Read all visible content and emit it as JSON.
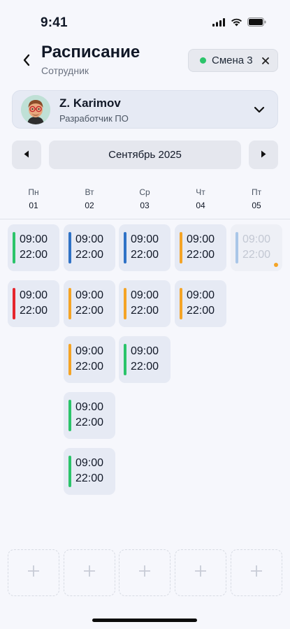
{
  "status_bar": {
    "time": "9:41"
  },
  "header": {
    "title": "Расписание",
    "subtitle": "Сотрудник",
    "shift_chip": {
      "label": "Смена 3",
      "dot_color": "#2bc46a"
    }
  },
  "employee": {
    "name": "Z. Karimov",
    "role": "Разработчик ПО"
  },
  "month": {
    "label": "Сентябрь 2025"
  },
  "days": [
    {
      "name": "Пн",
      "num": "01"
    },
    {
      "name": "Вт",
      "num": "02"
    },
    {
      "name": "Ср",
      "num": "03"
    },
    {
      "name": "Чт",
      "num": "04"
    },
    {
      "name": "Пт",
      "num": "05"
    }
  ],
  "colors": {
    "green": "#2bc46a",
    "blue": "#2f72c6",
    "orange": "#f4a426",
    "red": "#e5252d",
    "faded_blue": "#a9c6e8"
  },
  "shifts": [
    {
      "day": 0,
      "row": 0,
      "start": "09:00",
      "end": "22:00",
      "color": "green"
    },
    {
      "day": 0,
      "row": 1,
      "start": "09:00",
      "end": "22:00",
      "color": "red"
    },
    {
      "day": 1,
      "row": 0,
      "start": "09:00",
      "end": "22:00",
      "color": "blue"
    },
    {
      "day": 1,
      "row": 1,
      "start": "09:00",
      "end": "22:00",
      "color": "orange"
    },
    {
      "day": 1,
      "row": 2,
      "start": "09:00",
      "end": "22:00",
      "color": "orange"
    },
    {
      "day": 1,
      "row": 3,
      "start": "09:00",
      "end": "22:00",
      "color": "green"
    },
    {
      "day": 1,
      "row": 4,
      "start": "09:00",
      "end": "22:00",
      "color": "green"
    },
    {
      "day": 2,
      "row": 0,
      "start": "09:00",
      "end": "22:00",
      "color": "blue"
    },
    {
      "day": 2,
      "row": 1,
      "start": "09:00",
      "end": "22:00",
      "color": "orange"
    },
    {
      "day": 2,
      "row": 2,
      "start": "09:00",
      "end": "22:00",
      "color": "green"
    },
    {
      "day": 3,
      "row": 0,
      "start": "09:00",
      "end": "22:00",
      "color": "orange"
    },
    {
      "day": 3,
      "row": 1,
      "start": "09:00",
      "end": "22:00",
      "color": "orange"
    },
    {
      "day": 4,
      "row": 0,
      "start": "09:00",
      "end": "22:00",
      "color": "faded_blue",
      "faded": true,
      "marker": true
    }
  ],
  "icons": {
    "back": "chevron-left-icon",
    "close": "close-icon",
    "expand": "chevron-down-icon",
    "prev": "triangle-left-icon",
    "next": "triangle-right-icon",
    "add": "plus-icon"
  }
}
